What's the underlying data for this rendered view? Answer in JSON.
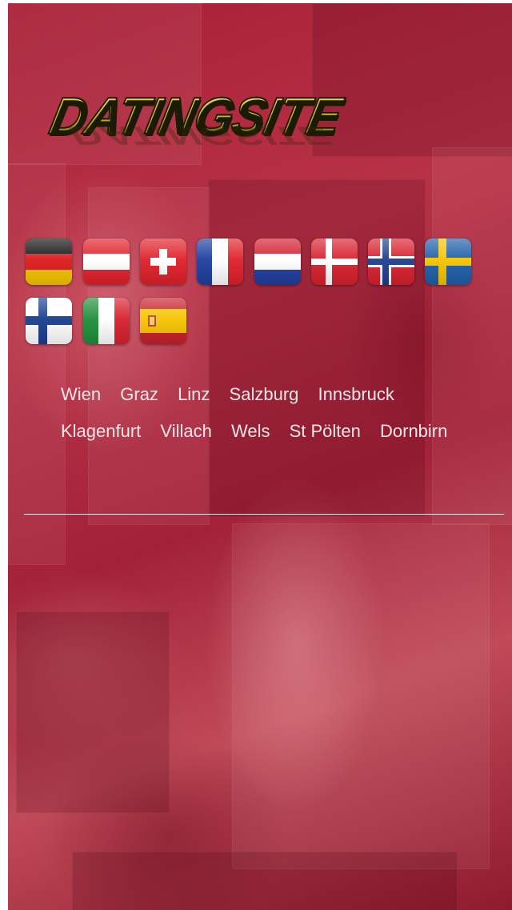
{
  "logo": {
    "text": "DATINGSITE",
    "colors": {
      "gold": "#d7c23a",
      "outline": "#1c1a05"
    }
  },
  "flags": [
    {
      "country": "Germany",
      "icon": "germany-flag-icon"
    },
    {
      "country": "Austria",
      "icon": "austria-flag-icon"
    },
    {
      "country": "Switzerland",
      "icon": "switzerland-flag-icon"
    },
    {
      "country": "France",
      "icon": "france-flag-icon"
    },
    {
      "country": "Netherlands",
      "icon": "netherlands-flag-icon"
    },
    {
      "country": "Denmark",
      "icon": "denmark-flag-icon"
    },
    {
      "country": "Norway",
      "icon": "norway-flag-icon"
    },
    {
      "country": "Sweden",
      "icon": "sweden-flag-icon"
    },
    {
      "country": "Finland",
      "icon": "finland-flag-icon"
    },
    {
      "country": "Italy",
      "icon": "italy-flag-icon"
    },
    {
      "country": "Spain",
      "icon": "spain-flag-icon"
    }
  ],
  "cities": [
    "Wien",
    "Graz",
    "Linz",
    "Salzburg",
    "Innsbruck",
    "Klagenfurt",
    "Villach",
    "Wels",
    "St Pölten",
    "Dornbirn"
  ],
  "theme": {
    "background": "#a81f36",
    "link_color": "#f1e7e9",
    "divider": "#ffffff"
  }
}
